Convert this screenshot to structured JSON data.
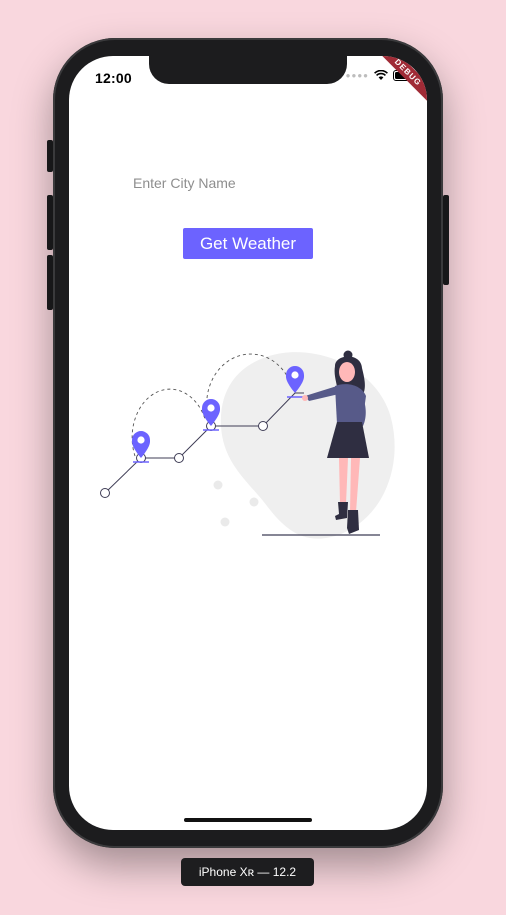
{
  "status_bar": {
    "time": "12:00",
    "debug_label": "DEBUG"
  },
  "form": {
    "city_placeholder": "Enter City Name",
    "city_value": "",
    "submit_label": "Get Weather"
  },
  "device_label": "iPhone Xʀ — 12.2",
  "colors": {
    "accent": "#6c63ff",
    "background": "#f9d7de",
    "debug_banner": "#a02b36"
  }
}
